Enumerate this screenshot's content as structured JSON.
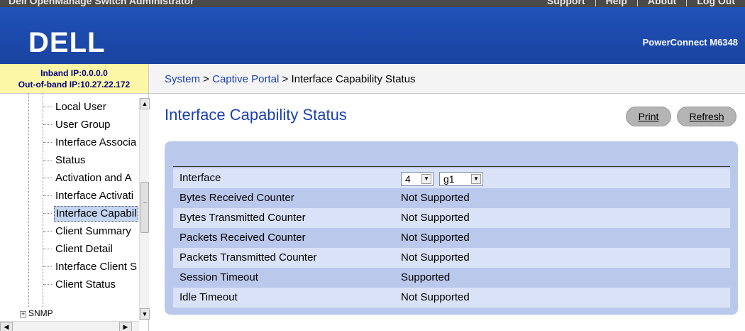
{
  "header": {
    "app_title": "Dell OpenManage Switch Administrator",
    "links": [
      "Support",
      "Help",
      "About",
      "Log Out"
    ],
    "logo": "DELL",
    "product": "PowerConnect M6348"
  },
  "ip_box": {
    "inband": "Inband IP:0.0.0.0",
    "outofband": "Out-of-band IP:10.27.22.172"
  },
  "breadcrumb": {
    "system": "System",
    "sep1": " > ",
    "captive_portal": "Captive Portal",
    "sep2": " > ",
    "current": "Interface Capability Status"
  },
  "tree": {
    "items": [
      {
        "label": "Local User"
      },
      {
        "label": "User Group"
      },
      {
        "label": "Interface Associa"
      },
      {
        "label": "Status"
      },
      {
        "label": "Activation and A"
      },
      {
        "label": "Interface Activati"
      },
      {
        "label": "Interface Capabil"
      },
      {
        "label": "Client Summary"
      },
      {
        "label": "Client Detail"
      },
      {
        "label": "Interface Client S"
      },
      {
        "label": "Client Status"
      }
    ],
    "selected_index": 6,
    "next_section": "SNMP"
  },
  "page": {
    "title": "Interface Capability Status",
    "print_label": "Print",
    "refresh_label": "Refresh"
  },
  "interface": {
    "label": "Interface",
    "unit": "4",
    "port": "g1"
  },
  "rows": [
    {
      "label": "Bytes Received Counter",
      "value": "Not Supported"
    },
    {
      "label": "Bytes Transmitted Counter",
      "value": "Not Supported"
    },
    {
      "label": "Packets Received Counter",
      "value": "Not Supported"
    },
    {
      "label": "Packets Transmitted Counter",
      "value": "Not Supported"
    },
    {
      "label": "Session Timeout",
      "value": "Supported"
    },
    {
      "label": "Idle Timeout",
      "value": "Not Supported"
    }
  ],
  "colors": {
    "banner": "#1d47a8",
    "ip_box": "#fcf7a6",
    "panel": "#bac8ec",
    "link": "#1a3fb0"
  },
  "icons": [
    "chevron-down-icon",
    "scroll-up-icon",
    "scroll-down-icon",
    "scroll-left-icon",
    "scroll-right-icon",
    "tree-expand-icon"
  ]
}
